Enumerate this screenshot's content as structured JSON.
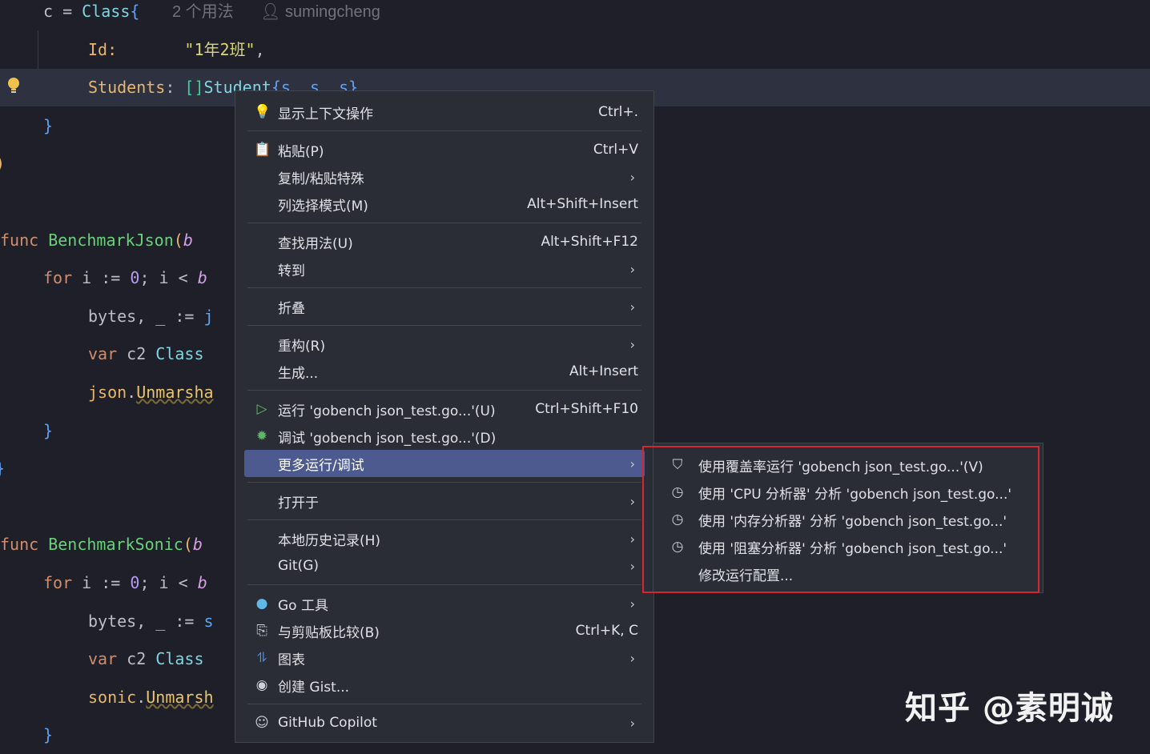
{
  "editor": {
    "lines": [
      {
        "indent": 54,
        "tokens": [
          [
            "c = ",
            "pl"
          ],
          [
            "Class",
            "ty"
          ],
          [
            "{",
            "br"
          ]
        ]
      },
      {
        "indent": 110,
        "tokens": [
          [
            "Id:",
            "fld"
          ],
          [
            "       ",
            "pl"
          ],
          [
            "\"1年2班\"",
            "str"
          ],
          [
            ",",
            "pl"
          ]
        ]
      },
      {
        "indent": 110,
        "hl": true,
        "tokens": [
          [
            "Students",
            "fld"
          ],
          [
            ": ",
            "pl"
          ],
          [
            "[]",
            "brg"
          ],
          [
            "Student",
            "ty"
          ],
          [
            "{s, s, s}",
            "br"
          ]
        ]
      },
      {
        "indent": 54,
        "tokens": [
          [
            "}",
            "br"
          ]
        ]
      },
      {
        "indent": -6,
        "tokens": [
          [
            ")",
            "fld"
          ]
        ]
      },
      {
        "indent": 0,
        "tokens": []
      },
      {
        "indent": 0,
        "tokens": [
          [
            "func ",
            "kw"
          ],
          [
            "BenchmarkJson",
            "fnd"
          ],
          [
            "(",
            "fld"
          ],
          [
            "b",
            "par"
          ]
        ]
      },
      {
        "indent": 54,
        "tokens": [
          [
            "for ",
            "kw"
          ],
          [
            "i := ",
            "pl"
          ],
          [
            "0",
            "num"
          ],
          [
            "; i < ",
            "pl"
          ],
          [
            "b",
            "par"
          ]
        ]
      },
      {
        "indent": 110,
        "tokens": [
          [
            "bytes, _ := ",
            "pl"
          ],
          [
            "j",
            "fn"
          ]
        ]
      },
      {
        "indent": 110,
        "tokens": [
          [
            "var ",
            "kw"
          ],
          [
            "c2 ",
            "pl"
          ],
          [
            "Class",
            "ty"
          ]
        ]
      },
      {
        "indent": 110,
        "tokens": [
          [
            "json",
            "fld"
          ],
          [
            ".",
            "pl"
          ],
          [
            "Unmarsha",
            "mth"
          ]
        ]
      },
      {
        "indent": 54,
        "tokens": [
          [
            "}",
            "br"
          ]
        ]
      },
      {
        "indent": -6,
        "tokens": [
          [
            "}",
            "br"
          ]
        ]
      },
      {
        "indent": 0,
        "tokens": []
      },
      {
        "indent": 0,
        "tokens": [
          [
            "func ",
            "kw"
          ],
          [
            "BenchmarkSonic",
            "fnd"
          ],
          [
            "(",
            "fld"
          ],
          [
            "b",
            "par"
          ]
        ]
      },
      {
        "indent": 54,
        "tokens": [
          [
            "for ",
            "kw"
          ],
          [
            "i := ",
            "pl"
          ],
          [
            "0",
            "num"
          ],
          [
            "; i < ",
            "pl"
          ],
          [
            "b",
            "par"
          ]
        ]
      },
      {
        "indent": 110,
        "tokens": [
          [
            "bytes, _ := ",
            "pl"
          ],
          [
            "s",
            "fn"
          ]
        ]
      },
      {
        "indent": 110,
        "tokens": [
          [
            "var ",
            "kw"
          ],
          [
            "c2 ",
            "pl"
          ],
          [
            "Class",
            "ty"
          ]
        ]
      },
      {
        "indent": 110,
        "tokens": [
          [
            "sonic",
            "fld"
          ],
          [
            ".",
            "pl"
          ],
          [
            "Unmarsh",
            "mth"
          ]
        ]
      },
      {
        "indent": 54,
        "tokens": [
          [
            "}",
            "br"
          ]
        ]
      }
    ],
    "usage_hint": "2 个用法",
    "author_hint": "sumingcheng"
  },
  "menu": {
    "groups": [
      [
        {
          "icon": "lightbulb-icon",
          "glyph": "💡",
          "label": "显示上下文操作",
          "shortcut": "Ctrl+."
        }
      ],
      [
        {
          "icon": "clipboard-icon",
          "glyph": "📋",
          "label": "粘贴(P)",
          "shortcut": "Ctrl+V"
        },
        {
          "label": "复制/粘贴特殊",
          "submenu": true
        },
        {
          "label": "列选择模式(M)",
          "shortcut": "Alt+Shift+Insert"
        }
      ],
      [
        {
          "label": "查找用法(U)",
          "shortcut": "Alt+Shift+F12"
        },
        {
          "label": "转到",
          "submenu": true
        }
      ],
      [
        {
          "label": "折叠",
          "submenu": true
        }
      ],
      [
        {
          "label": "重构(R)",
          "submenu": true
        },
        {
          "label": "生成...",
          "shortcut": "Alt+Insert"
        }
      ],
      [
        {
          "icon": "run-icon",
          "glyph": "▷",
          "color": "#5fb865",
          "label": "运行 'gobench json_test.go...'(U)",
          "shortcut": "Ctrl+Shift+F10"
        },
        {
          "icon": "debug-icon",
          "glyph": "✹",
          "color": "#5fb865",
          "label": "调试 'gobench json_test.go...'(D)"
        },
        {
          "label": "更多运行/调试",
          "submenu": true,
          "active": true
        }
      ],
      [
        {
          "label": "打开于",
          "submenu": true
        }
      ],
      [
        {
          "label": "本地历史记录(H)",
          "submenu": true
        },
        {
          "label": "Git(G)",
          "submenu": true
        }
      ],
      [
        {
          "icon": "gopher-icon",
          "glyph": "●",
          "color": "#5fb8e8",
          "label": "Go 工具",
          "submenu": true
        },
        {
          "icon": "compare-clipboard-icon",
          "glyph": "⎘",
          "label": "与剪贴板比较(B)",
          "shortcut": "Ctrl+K, C"
        },
        {
          "icon": "diagram-icon",
          "glyph": "⥮",
          "color": "#5fa0f5",
          "label": "图表",
          "submenu": true
        },
        {
          "icon": "github-icon",
          "glyph": "◉",
          "label": "创建 Gist..."
        }
      ],
      [
        {
          "icon": "copilot-icon",
          "glyph": "☺",
          "label": "GitHub Copilot",
          "submenu": true
        }
      ]
    ]
  },
  "submenu": {
    "items": [
      {
        "icon": "coverage-run-icon",
        "glyph": "⛉",
        "label": "使用覆盖率运行 'gobench json_test.go...'(V)"
      },
      {
        "icon": "profiler-icon",
        "glyph": "◷",
        "label": "使用 'CPU 分析器' 分析  'gobench json_test.go...'"
      },
      {
        "icon": "profiler-icon",
        "glyph": "◷",
        "label": "使用 '内存分析器' 分析  'gobench json_test.go...'"
      },
      {
        "icon": "profiler-icon",
        "glyph": "◷",
        "label": "使用 '阻塞分析器' 分析  'gobench json_test.go...'"
      },
      {
        "label": "修改运行配置..."
      }
    ]
  },
  "watermark": "知乎 @素明诚",
  "colors": {
    "highlight": "#4c5a8f",
    "annotation_box": "#d6262f"
  }
}
